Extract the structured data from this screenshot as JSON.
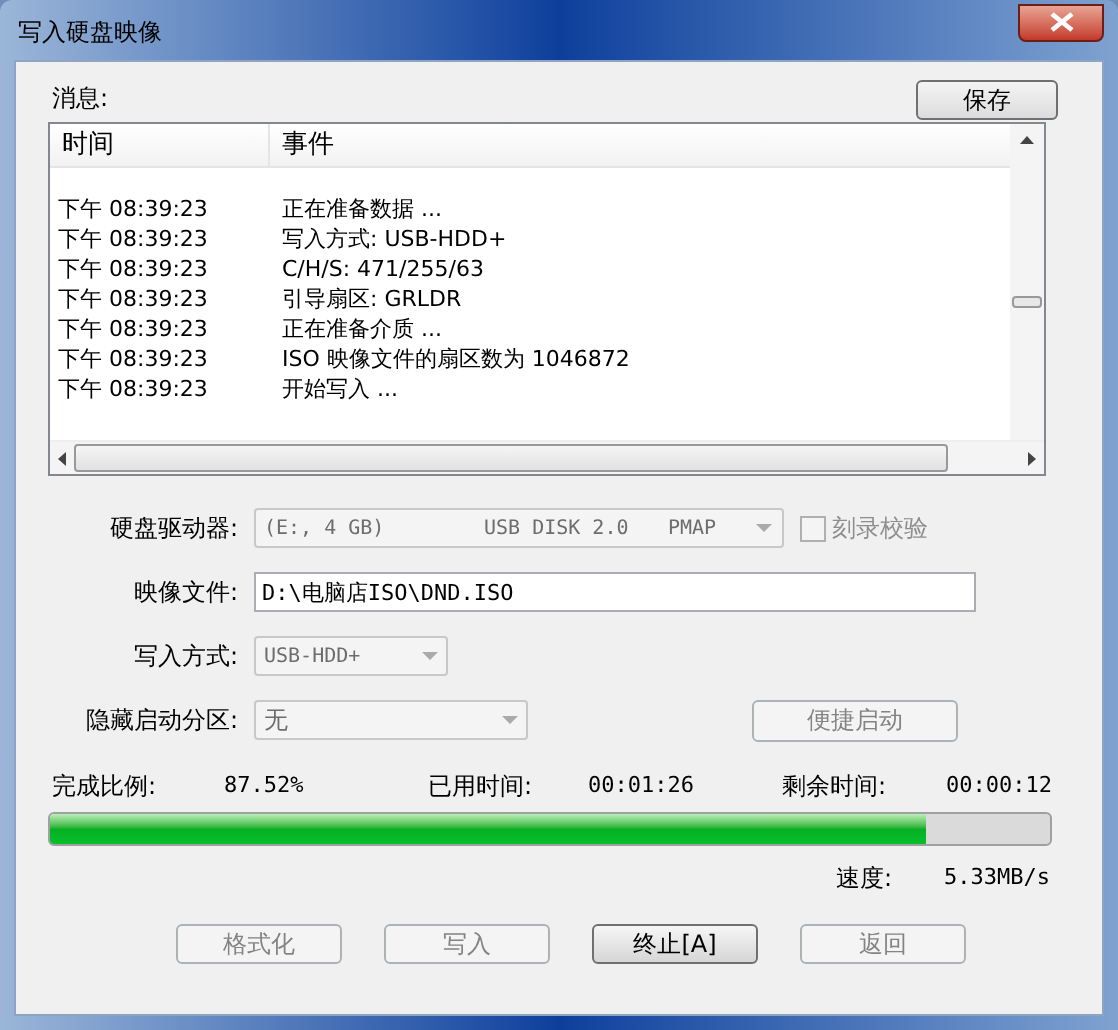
{
  "window": {
    "title": "写入硬盘映像"
  },
  "messages": {
    "label": "消息:",
    "save_button": "保存",
    "columns": [
      "时间",
      "事件"
    ],
    "rows": [
      {
        "time": "下午 08:39:23",
        "event": "正在准备数据 ..."
      },
      {
        "time": "下午 08:39:23",
        "event": "写入方式: USB-HDD+"
      },
      {
        "time": "下午 08:39:23",
        "event": "C/H/S: 471/255/63"
      },
      {
        "time": "下午 08:39:23",
        "event": "引导扇区: GRLDR"
      },
      {
        "time": "下午 08:39:23",
        "event": "正在准备介质 ..."
      },
      {
        "time": "下午 08:39:23",
        "event": "ISO 映像文件的扇区数为 1046872"
      },
      {
        "time": "下午 08:39:23",
        "event": "开始写入 ..."
      }
    ]
  },
  "drive": {
    "label": "硬盘驱动器:",
    "parts": [
      "(E:, 4 GB)",
      "USB DISK 2.0",
      "PMAP"
    ],
    "disabled": true
  },
  "verify": {
    "label": "刻录校验",
    "checked": false,
    "disabled": true
  },
  "image_file": {
    "label": "映像文件:",
    "value": "D:\\电脑店ISO\\DND.ISO"
  },
  "write_mode": {
    "label": "写入方式:",
    "value": "USB-HDD+",
    "disabled": true
  },
  "hidden_partition": {
    "label": "隐藏启动分区:",
    "value": "无",
    "disabled": true
  },
  "quick_boot": {
    "label": "便捷启动",
    "disabled": true
  },
  "progress": {
    "percent_label": "完成比例:",
    "percent": "87.52%",
    "elapsed_label": "已用时间:",
    "elapsed": "00:01:26",
    "remaining_label": "剩余时间:",
    "remaining": "00:00:12",
    "level": 0.8752,
    "speed_label": "速度:",
    "speed": "5.33MB/s"
  },
  "buttons": [
    {
      "label": "格式化",
      "disabled": true
    },
    {
      "label": "写入",
      "disabled": true
    },
    {
      "label": "终止[A]",
      "disabled": false
    },
    {
      "label": "返回",
      "disabled": true
    }
  ]
}
